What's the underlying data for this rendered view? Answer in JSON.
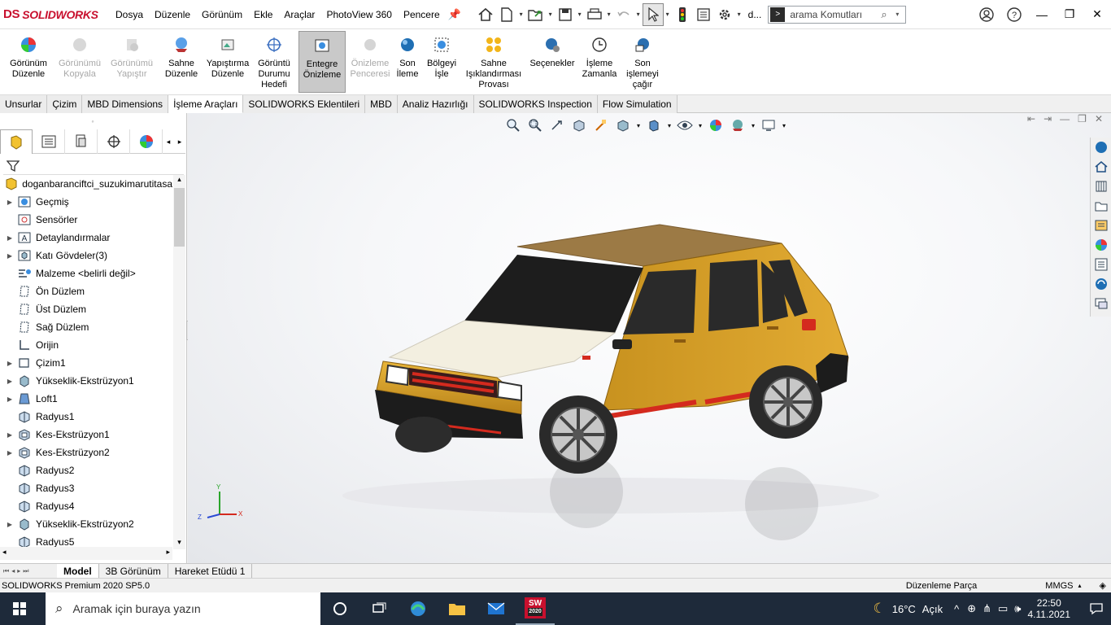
{
  "app": {
    "logo_text": "SOLIDWORKS"
  },
  "menu": [
    "Dosya",
    "Düzenle",
    "Görünüm",
    "Ekle",
    "Araçlar",
    "PhotoView 360",
    "Pencere"
  ],
  "titlebar": {
    "doc_short": "d...",
    "search_placeholder": "arama Komutları"
  },
  "ribbon": [
    {
      "label1": "Görünüm",
      "label2": "Düzenle",
      "state": "normal"
    },
    {
      "label1": "Görünümü",
      "label2": "Kopyala",
      "state": "disabled"
    },
    {
      "label1": "Görünümü",
      "label2": "Yapıştır",
      "state": "disabled"
    },
    {
      "label1": "Sahne",
      "label2": "Düzenle",
      "state": "normal"
    },
    {
      "label1": "Yapıştırma",
      "label2": "Düzenle",
      "state": "normal"
    },
    {
      "label1": "Görüntü",
      "label2": "Durumu",
      "label3": "Hedefi",
      "state": "normal"
    },
    {
      "label1": "Entegre",
      "label2": "Önizleme",
      "state": "active"
    },
    {
      "label1": "Önizleme",
      "label2": "Penceresi",
      "state": "disabled"
    },
    {
      "label1": "Son",
      "label2": "İleme",
      "state": "normal"
    },
    {
      "label1": "Bölgeyi",
      "label2": "İşle",
      "state": "normal"
    },
    {
      "label1": "Sahne",
      "label2": "Işıklandırması",
      "label3": "Provası",
      "state": "normal"
    },
    {
      "label1": "Seçenekler",
      "state": "normal"
    },
    {
      "label1": "İşleme",
      "label2": "Zamanla",
      "state": "normal"
    },
    {
      "label1": "Son",
      "label2": "işlemeyi",
      "label3": "çağır",
      "state": "normal"
    }
  ],
  "tabs": [
    "Unsurlar",
    "Çizim",
    "MBD Dimensions",
    "İşleme Araçları",
    "SOLIDWORKS Eklentileri",
    "MBD",
    "Analiz Hazırlığı",
    "SOLIDWORKS Inspection",
    "Flow Simulation"
  ],
  "active_tab": "İşleme Araçları",
  "tree": {
    "root": "doganbaranciftci_suzukimarutitasa",
    "items": [
      {
        "label": "Geçmiş",
        "expandable": true,
        "icon": "history-icon"
      },
      {
        "label": "Sensörler",
        "expandable": false,
        "icon": "sensor-icon"
      },
      {
        "label": "Detaylandırmalar",
        "expandable": true,
        "icon": "annotation-icon"
      },
      {
        "label": "Katı Gövdeler(3)",
        "expandable": true,
        "icon": "solid-bodies-icon"
      },
      {
        "label": "Malzeme <belirli değil>",
        "expandable": false,
        "icon": "material-icon"
      },
      {
        "label": "Ön Düzlem",
        "expandable": false,
        "icon": "plane-icon"
      },
      {
        "label": "Üst Düzlem",
        "expandable": false,
        "icon": "plane-icon"
      },
      {
        "label": "Sağ Düzlem",
        "expandable": false,
        "icon": "plane-icon"
      },
      {
        "label": "Orijin",
        "expandable": false,
        "icon": "origin-icon"
      },
      {
        "label": "Çizim1",
        "expandable": true,
        "icon": "sketch-icon"
      },
      {
        "label": "Yükseklik-Ekstrüzyon1",
        "expandable": true,
        "icon": "extrude-icon"
      },
      {
        "label": "Loft1",
        "expandable": true,
        "icon": "loft-icon"
      },
      {
        "label": "Radyus1",
        "expandable": false,
        "icon": "fillet-icon"
      },
      {
        "label": "Kes-Ekstrüzyon1",
        "expandable": true,
        "icon": "cut-extrude-icon"
      },
      {
        "label": "Kes-Ekstrüzyon2",
        "expandable": true,
        "icon": "cut-extrude-icon"
      },
      {
        "label": "Radyus2",
        "expandable": false,
        "icon": "fillet-icon"
      },
      {
        "label": "Radyus3",
        "expandable": false,
        "icon": "fillet-icon"
      },
      {
        "label": "Radyus4",
        "expandable": false,
        "icon": "fillet-icon"
      },
      {
        "label": "Yükseklik-Ekstrüzyon2",
        "expandable": true,
        "icon": "extrude-icon"
      },
      {
        "label": "Radyus5",
        "expandable": false,
        "icon": "fillet-icon"
      }
    ]
  },
  "triad": {
    "x": "X",
    "y": "Y",
    "z": "Z"
  },
  "bottom_tabs": [
    "Model",
    "3B Görünüm",
    "Hareket Etüdü 1"
  ],
  "status": {
    "version": "SOLIDWORKS Premium 2020 SP5.0",
    "mode": "Düzenleme Parça",
    "units": "MMGS"
  },
  "taskbar": {
    "search": "Aramak için buraya yazın",
    "temp": "16°C",
    "weather": "Açık",
    "time": "22:50",
    "date": "4.11.2021",
    "sw_badge": "2020"
  },
  "colors": {
    "car_body": "#d8a21f",
    "car_hood": "#f3efe0",
    "roof": "#9c7a45",
    "accent_red": "#d42a1e",
    "taskbar": "#1e2a3a"
  }
}
